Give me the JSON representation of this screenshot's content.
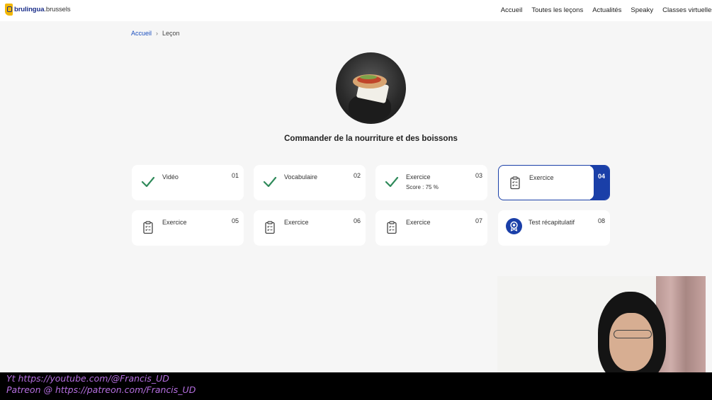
{
  "header": {
    "logo_primary": "brulingua",
    "logo_secondary": ".brussels",
    "nav": [
      "Accueil",
      "Toutes les leçons",
      "Actualités",
      "Speaky",
      "Classes virtuelles"
    ]
  },
  "breadcrumb": {
    "home": "Accueil",
    "separator": "›",
    "current": "Leçon"
  },
  "lesson": {
    "title": "Commander de la nourriture et des boissons"
  },
  "steps": [
    {
      "title": "Vidéo",
      "number": "01",
      "status": "done",
      "icon": "check-icon",
      "subtitle": ""
    },
    {
      "title": "Vocabulaire",
      "number": "02",
      "status": "done",
      "icon": "check-icon",
      "subtitle": ""
    },
    {
      "title": "Exercice",
      "number": "03",
      "status": "done",
      "icon": "check-icon",
      "subtitle": "Score : 75 %"
    },
    {
      "title": "Exercice",
      "number": "04",
      "status": "active",
      "icon": "clipboard-icon",
      "subtitle": ""
    },
    {
      "title": "Exercice",
      "number": "05",
      "status": "todo",
      "icon": "clipboard-icon",
      "subtitle": ""
    },
    {
      "title": "Exercice",
      "number": "06",
      "status": "todo",
      "icon": "clipboard-icon",
      "subtitle": ""
    },
    {
      "title": "Exercice",
      "number": "07",
      "status": "todo",
      "icon": "clipboard-icon",
      "subtitle": ""
    },
    {
      "title": "Test récapitulatif",
      "number": "08",
      "status": "todo",
      "icon": "award-badge-icon",
      "subtitle": ""
    }
  ],
  "overlay": {
    "line1": "Yt https://youtube.com/@Francis_UD",
    "line2": "Patreon @ https://patreon.com/Francis_UD"
  },
  "colors": {
    "brand_blue": "#1a3fa8",
    "check_green": "#2f8a5a",
    "logo_yellow": "#f2b705",
    "overlay_text": "#b56ee0"
  }
}
